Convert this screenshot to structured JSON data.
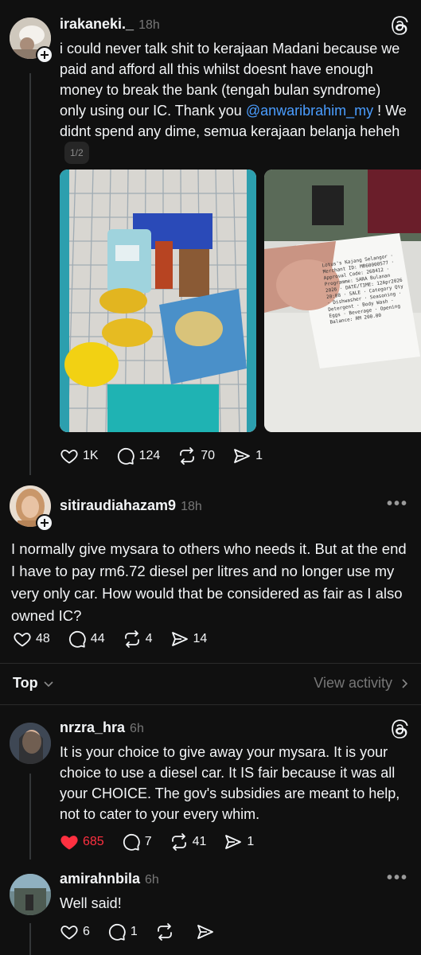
{
  "posts": [
    {
      "username": "irakaneki._",
      "time": "18h",
      "text_before": "i could never talk shit to kerajaan Madani because we paid and afford all this whilst doesnt have enough money to break the bank (tengah bulan syndrome) only using our IC. Thank you ",
      "mention": "@anwaribrahim_my",
      "text_after": " ! We didnt spend any dime, semua kerajaan belanja heheh",
      "pager": "1/2",
      "likes": "1K",
      "replies": "124",
      "reposts": "70",
      "shares": "1",
      "receipt_text": "Lotus's Kajang Selangor · Merchant ID: MB60000577 · Approval Code: 268412 · Programme: SARA Bulanan 2026 · DATE/TIME: 12Apr2026 20:08 · SALE · Category Qty · Dishwasher · Seasoning · Detergent · Body Wash · Eggs · Beverage · Opening Balance: RM 200.00"
    },
    {
      "username": "sitiraudiahazam9",
      "time": "18h",
      "text": "I normally give mysara to others who needs it. But at the end I have to pay rm6.72 diesel per litres and no longer use my very only car. How would that be considered as fair as I also owned IC?",
      "likes": "48",
      "replies": "44",
      "reposts": "4",
      "shares": "14"
    }
  ],
  "sort": {
    "label": "Top",
    "view_activity": "View activity"
  },
  "replies": [
    {
      "username": "nrzra_hra",
      "time": "6h",
      "text": "It is your choice to give away your mysara. It is your choice to use a diesel car. It IS fair because it was all your CHOICE. The gov's subsidies are meant to help, not to cater to your every whim.",
      "likes": "685",
      "replies": "7",
      "reposts": "41",
      "shares": "1",
      "liked_color": "#ff3040"
    },
    {
      "username": "amirahnbila",
      "time": "6h",
      "text": "Well said!",
      "likes": "6",
      "replies": "1",
      "reposts": "",
      "shares": ""
    }
  ],
  "icons": [
    "threads-logo-icon",
    "heart-icon",
    "comment-icon",
    "repost-icon",
    "share-icon",
    "more-icon",
    "chevron-right-icon",
    "chevron-down-icon",
    "plus-icon"
  ]
}
